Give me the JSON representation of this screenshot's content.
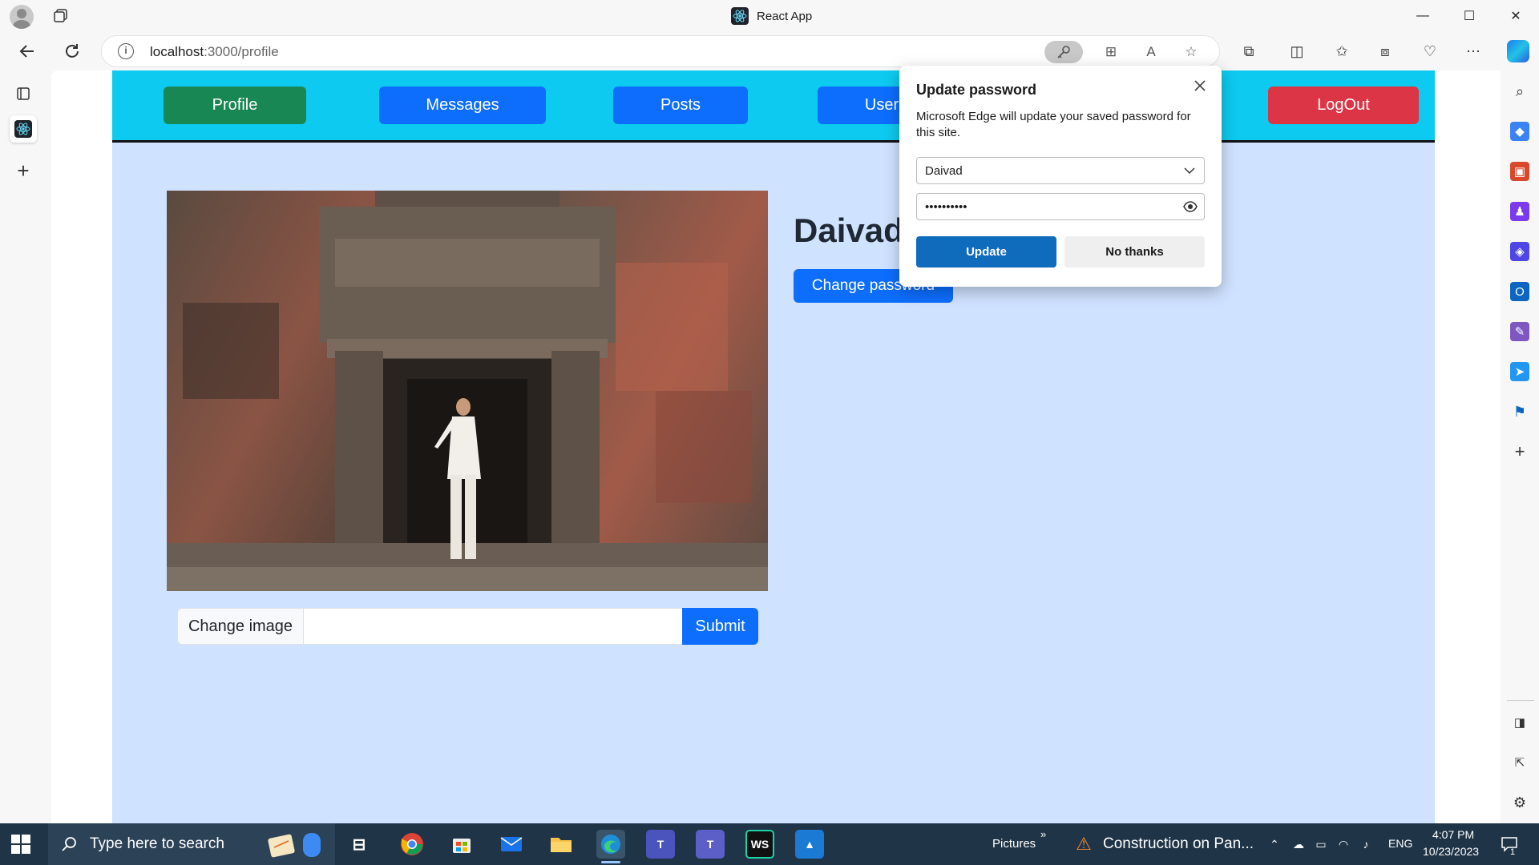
{
  "window": {
    "title": "React App",
    "controls": [
      "—",
      "☐",
      "✕"
    ]
  },
  "browser": {
    "url_host": "localhost",
    "url_path": ":3000/profile"
  },
  "app": {
    "nav": {
      "profile": "Profile",
      "messages": "Messages",
      "posts": "Posts",
      "users": "Users",
      "logout": "LogOut"
    },
    "username": "Daivad",
    "change_password": "Change password",
    "change_image": "Change image",
    "submit": "Submit"
  },
  "popup": {
    "title": "Update password",
    "description": "Microsoft Edge will update your saved password for this site.",
    "username_value": "Daivad",
    "password_value": "••••••••••",
    "update": "Update",
    "no_thanks": "No thanks"
  },
  "taskbar": {
    "search_placeholder": "Type here to search",
    "pictures": "Pictures",
    "news": "Construction on Pan...",
    "lang": "ENG",
    "time": "4:07 PM",
    "date": "10/23/2023",
    "notification_count": "1"
  },
  "colors": {
    "nav_bg": "#0dcaf0",
    "page_bg": "#cfe2ff",
    "primary": "#0d6efd",
    "success": "#198754",
    "danger": "#dc3545",
    "edge_blue": "#0f6cbd"
  }
}
